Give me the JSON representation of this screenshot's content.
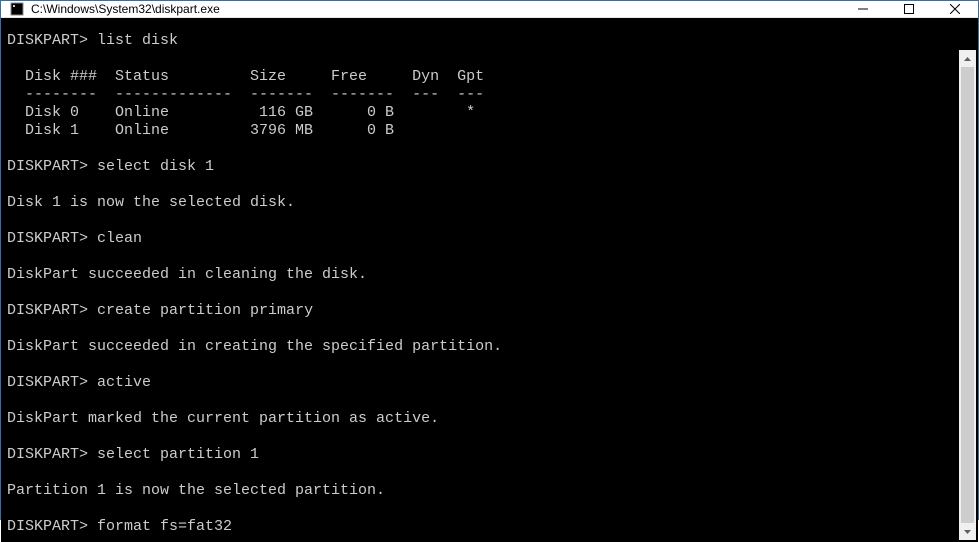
{
  "window": {
    "title": "C:\\Windows\\System32\\diskpart.exe"
  },
  "prompt": "DISKPART>",
  "session": {
    "cmd1": "list disk",
    "table_header": "  Disk ###  Status         Size     Free     Dyn  Gpt",
    "table_divider": "  --------  -------------  -------  -------  ---  ---",
    "table_row0": "  Disk 0    Online          116 GB      0 B        *",
    "table_row1": "  Disk 1    Online         3796 MB      0 B",
    "cmd2": "select disk 1",
    "resp2": "Disk 1 is now the selected disk.",
    "cmd3": "clean",
    "resp3": "DiskPart succeeded in cleaning the disk.",
    "cmd4": "create partition primary",
    "resp4": "DiskPart succeeded in creating the specified partition.",
    "cmd5": "active",
    "resp5": "DiskPart marked the current partition as active.",
    "cmd6": "select partition 1",
    "resp6": "Partition 1 is now the selected partition.",
    "cmd7": "format fs=fat32"
  }
}
